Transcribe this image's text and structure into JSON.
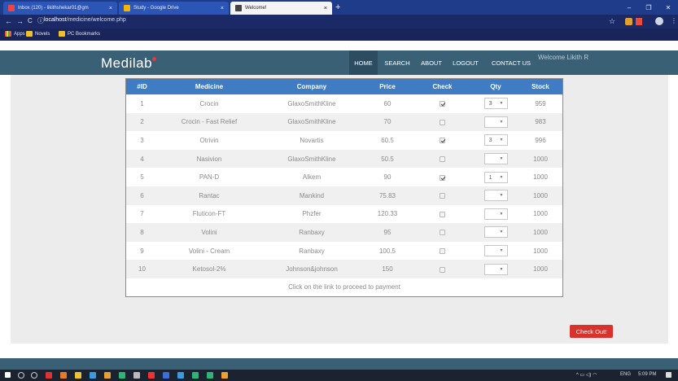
{
  "browser": {
    "tabs": [
      {
        "label": "Inbox (120) - likithshekar01@gm",
        "active": false
      },
      {
        "label": "Study - Google Drive",
        "active": false
      },
      {
        "label": "Welcome!",
        "active": true
      }
    ],
    "url_host": "localhost",
    "url_path": "/medicine/welcome.php",
    "bookmarks": [
      "Apps",
      "Novels",
      "PC Bookmarks"
    ]
  },
  "site": {
    "logo": "Medilab",
    "nav": [
      "HOME",
      "SEARCH",
      "ABOUT",
      "LOGOUT",
      "CONTACT US"
    ],
    "welcome": "Welcome Likith R"
  },
  "table": {
    "columns": [
      "#ID",
      "Medicine",
      "Company",
      "Price",
      "Check",
      "Qty",
      "Stock"
    ],
    "rows": [
      {
        "id": "1",
        "medicine": "Crocin",
        "company": "GlaxoSmithKline",
        "price": "60",
        "checked": true,
        "qty": "3",
        "stock": "959"
      },
      {
        "id": "2",
        "medicine": "Crocin - Fast Relief",
        "company": "GlaxoSmithKline",
        "price": "70",
        "checked": false,
        "qty": "",
        "stock": "983"
      },
      {
        "id": "3",
        "medicine": "Otrivin",
        "company": "Novartis",
        "price": "60.5",
        "checked": true,
        "qty": "3",
        "stock": "996"
      },
      {
        "id": "4",
        "medicine": "Nasivion",
        "company": "GlaxoSmithKline",
        "price": "50.5",
        "checked": false,
        "qty": "",
        "stock": "1000"
      },
      {
        "id": "5",
        "medicine": "PAN-D",
        "company": "Alkem",
        "price": "90",
        "checked": true,
        "qty": "1",
        "stock": "1000"
      },
      {
        "id": "6",
        "medicine": "Rantac",
        "company": "Mankind",
        "price": "75.83",
        "checked": false,
        "qty": "",
        "stock": "1000"
      },
      {
        "id": "7",
        "medicine": "Fluticon-FT",
        "company": "Phzfer",
        "price": "120.33",
        "checked": false,
        "qty": "",
        "stock": "1000"
      },
      {
        "id": "8",
        "medicine": "Volini",
        "company": "Ranbaxy",
        "price": "95",
        "checked": false,
        "qty": "",
        "stock": "1000"
      },
      {
        "id": "9",
        "medicine": "Volini - Cream",
        "company": "Ranbaxy",
        "price": "100.5",
        "checked": false,
        "qty": "",
        "stock": "1000"
      },
      {
        "id": "10",
        "medicine": "Ketosol-2%",
        "company": "Johnson&johnson",
        "price": "150",
        "checked": false,
        "qty": "",
        "stock": "1000"
      }
    ],
    "footer": "Click on the link to proceed to payment"
  },
  "checkout_label": "Check Out!",
  "tray": {
    "lang": "ENG",
    "time": "5:09 PM"
  },
  "icons": {
    "tab_close": "×",
    "new_tab": "+",
    "back": "←",
    "forward": "→",
    "reload": "C",
    "info": "ⓘ",
    "star": "☆",
    "minimize": "–",
    "maximize": "❐",
    "close": "✕",
    "dropdown": "▼"
  }
}
